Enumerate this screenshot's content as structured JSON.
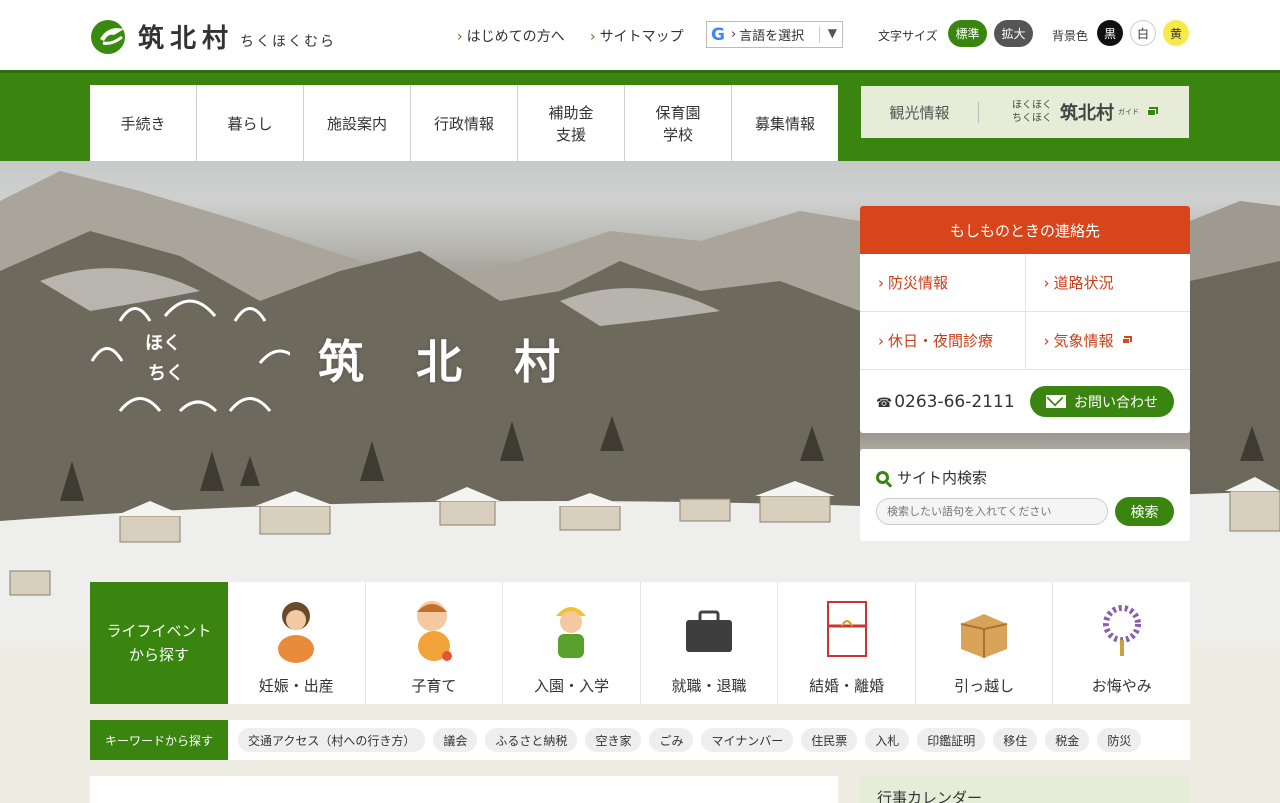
{
  "header": {
    "logo_name": "筑北村",
    "logo_kana": "ちくほくむら",
    "links": [
      "はじめての方へ",
      "サイトマップ"
    ],
    "translate_label": "言語を選択",
    "font_size_label": "文字サイズ",
    "font_size_standard": "標準",
    "font_size_large": "拡大",
    "bg_color_label": "背景色",
    "bg_black": "黒",
    "bg_white": "白",
    "bg_yellow": "黄"
  },
  "nav": {
    "items": [
      {
        "line1": "手続き",
        "line2": ""
      },
      {
        "line1": "暮らし",
        "line2": ""
      },
      {
        "line1": "施設案内",
        "line2": ""
      },
      {
        "line1": "行政情報",
        "line2": ""
      },
      {
        "line1": "補助金",
        "line2": "支援"
      },
      {
        "line1": "保育園",
        "line2": "学校"
      },
      {
        "line1": "募集情報",
        "line2": ""
      }
    ],
    "tourism": "観光情報",
    "guide_kana_1": "ほくほく",
    "guide_kana_2": "ちくほく",
    "guide_big": "筑北村",
    "guide_small": "ガイド"
  },
  "hero": {
    "title": "筑北村",
    "kana_1": "ほく",
    "kana_2": "ちく"
  },
  "emergency": {
    "title": "もしものときの連絡先",
    "links": [
      "防災情報",
      "道路状況",
      "休日・夜間診療",
      "気象情報"
    ],
    "phone": "0263-66-2111",
    "contact": "お問い合わせ"
  },
  "search": {
    "title": "サイト内検索",
    "placeholder": "検索したい語句を入れてください",
    "button": "検索"
  },
  "life_events": {
    "heading_1": "ライフイベント",
    "heading_2": "から探す",
    "items": [
      "妊娠・出産",
      "子育て",
      "入園・入学",
      "就職・退職",
      "結婚・離婚",
      "引っ越し",
      "お悔やみ"
    ]
  },
  "keywords": {
    "heading": "キーワードから探す",
    "tags": [
      "交通アクセス（村への行き方）",
      "議会",
      "ふるさと納税",
      "空き家",
      "ごみ",
      "マイナンバー",
      "住民票",
      "入札",
      "印鑑証明",
      "移住",
      "税金",
      "防災"
    ]
  },
  "calendar": {
    "title": "行事カレンダー"
  },
  "colors": {
    "brand_green": "#3a850f",
    "alert_red": "#d9451b"
  }
}
